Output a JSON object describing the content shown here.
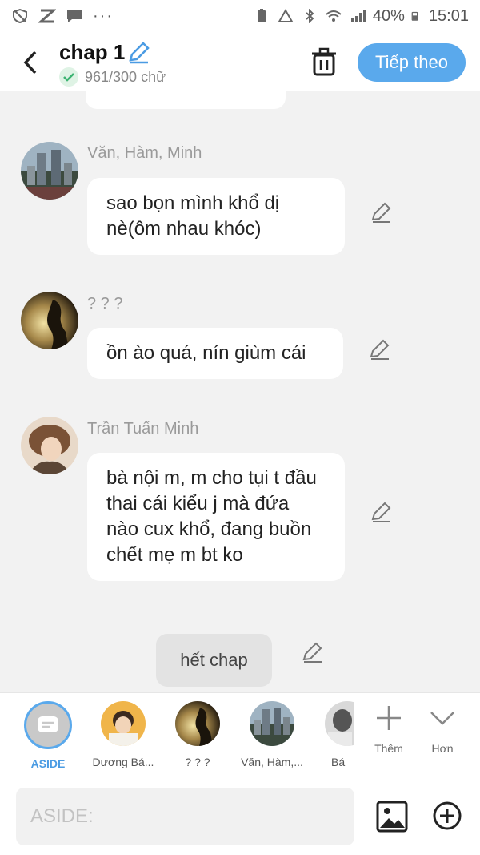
{
  "status_bar": {
    "battery": "40%",
    "time": "15:01",
    "dots": "···"
  },
  "header": {
    "title": "chap 1",
    "word_count": "961/300 chữ",
    "next_label": "Tiếp theo"
  },
  "messages": [
    {
      "sender": "Văn, Hàm, Minh",
      "text": "sao bọn mình khổ dị nè(ôm nhau khóc)"
    },
    {
      "sender": "? ? ?",
      "text": "ồn ào quá, nín giùm cái"
    },
    {
      "sender": "Trần Tuấn Minh",
      "text": "bà nội m, m cho tụi t đầu thai cái kiểu j mà đứa nào cux khổ, đang buồn chết mẹ m bt ko"
    }
  ],
  "aside_message": "hết chap",
  "characters": [
    {
      "label": "ASIDE"
    },
    {
      "label": "Dương Bá..."
    },
    {
      "label": "? ? ?"
    },
    {
      "label": "Văn, Hàm,..."
    },
    {
      "label": "Bá"
    }
  ],
  "tools": {
    "more_label": "Thêm",
    "less_label": "Hơn"
  },
  "input": {
    "placeholder": "ASIDE:"
  },
  "colors": {
    "accent": "#5aa9ec",
    "background": "#f2f2f2"
  }
}
